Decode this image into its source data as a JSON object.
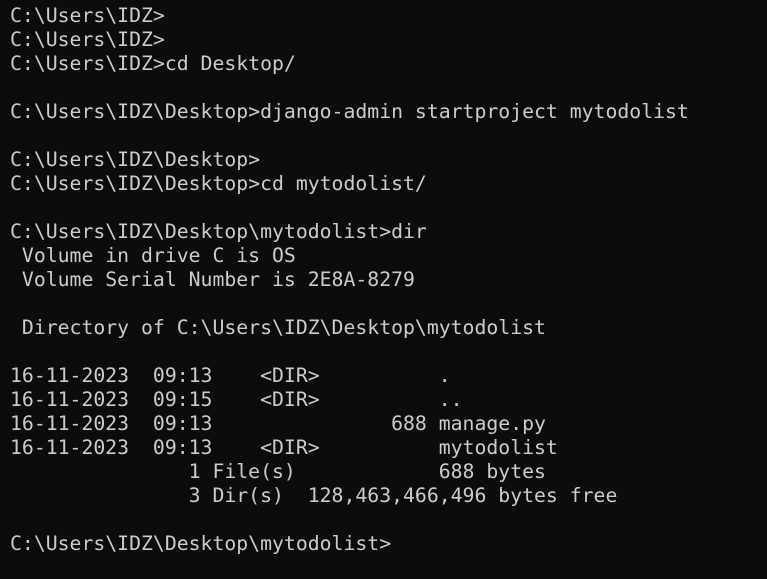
{
  "terminal": {
    "background_color": "#0c0c0c",
    "text_color": "#cccccc",
    "lines": [
      "C:\\Users\\IDZ>",
      "C:\\Users\\IDZ>",
      "C:\\Users\\IDZ>cd Desktop/",
      "",
      "C:\\Users\\IDZ\\Desktop>django-admin startproject mytodolist",
      "",
      "C:\\Users\\IDZ\\Desktop>",
      "C:\\Users\\IDZ\\Desktop>cd mytodolist/",
      "",
      "C:\\Users\\IDZ\\Desktop\\mytodolist>dir",
      " Volume in drive C is OS",
      " Volume Serial Number is 2E8A-8279",
      "",
      " Directory of C:\\Users\\IDZ\\Desktop\\mytodolist",
      "",
      "16-11-2023  09:13    <DIR>          .",
      "16-11-2023  09:15    <DIR>          ..",
      "16-11-2023  09:13               688 manage.py",
      "16-11-2023  09:13    <DIR>          mytodolist",
      "               1 File(s)            688 bytes",
      "               3 Dir(s)  128,463,466,496 bytes free",
      "",
      "C:\\Users\\IDZ\\Desktop\\mytodolist>"
    ]
  }
}
